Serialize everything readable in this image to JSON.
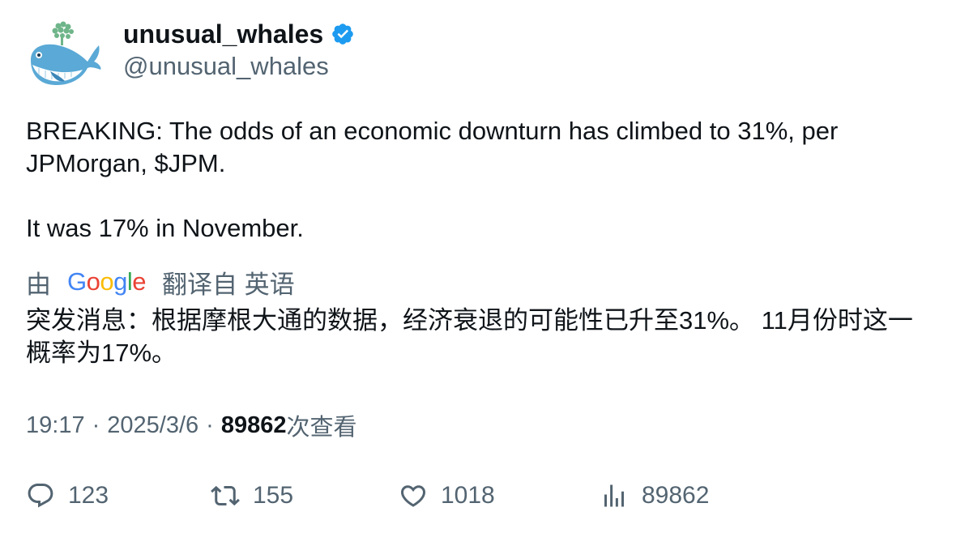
{
  "author": {
    "display_name": "unusual_whales",
    "handle": "@unusual_whales",
    "verified": true,
    "avatar_icon": "whale-icon"
  },
  "tweet": {
    "line1": "BREAKING: The odds of an economic downturn has climbed to 31%, per JPMorgan, $JPM.",
    "line2": "It was 17% in November."
  },
  "translation": {
    "by_label": "由",
    "provider": "Google",
    "translated_from_label": "翻译自 英语",
    "text": "突发消息：根据摩根大通的数据，经济衰退的可能性已升至31%。 11月份时这一概率为17%。"
  },
  "meta": {
    "time": "19:17",
    "separator": "·",
    "date": "2025/3/6",
    "views_count": "89862",
    "views_label": "次查看"
  },
  "actions": {
    "replies": "123",
    "retweets": "155",
    "likes": "1018",
    "views": "89862"
  },
  "colors": {
    "text_primary": "#0f1419",
    "text_secondary": "#536471",
    "verified_blue": "#1d9bf0"
  }
}
